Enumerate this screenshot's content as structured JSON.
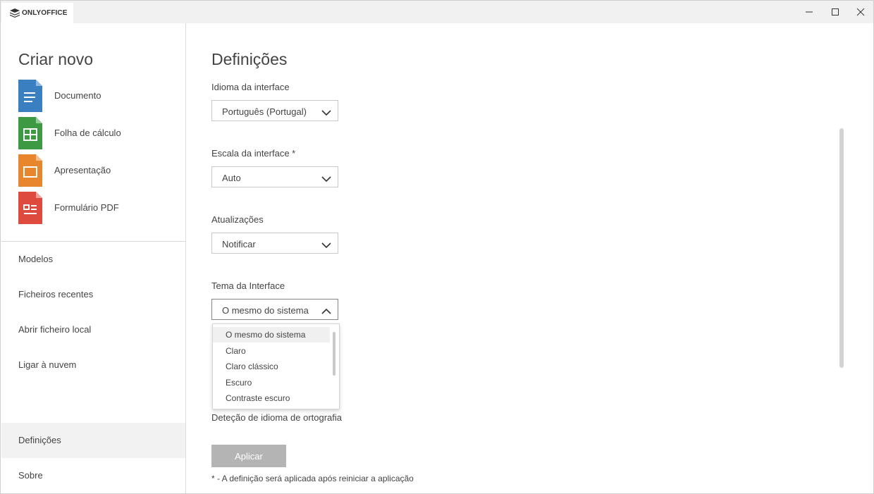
{
  "titlebar": {
    "app_name": "ONLYOFFICE",
    "icons": [
      "onlyoffice-logo-icon",
      "minimize-icon",
      "maximize-icon",
      "close-icon"
    ]
  },
  "sidebar": {
    "create_title": "Criar novo",
    "create_items": [
      {
        "label": "Documento",
        "icon": "document-icon",
        "color": "#3a7fbf"
      },
      {
        "label": "Folha de cálculo",
        "icon": "spreadsheet-icon",
        "color": "#3e9a42"
      },
      {
        "label": "Apresentação",
        "icon": "presentation-icon",
        "color": "#e7862d"
      },
      {
        "label": "Formulário PDF",
        "icon": "pdf-form-icon",
        "color": "#df4a3e"
      }
    ],
    "nav_items": [
      {
        "label": "Modelos"
      },
      {
        "label": "Ficheiros recentes"
      },
      {
        "label": "Abrir ficheiro local"
      },
      {
        "label": "Ligar à nuvem"
      },
      {
        "label": "Definições",
        "active": true
      },
      {
        "label": "Sobre"
      }
    ]
  },
  "main": {
    "title": "Definições",
    "fields": [
      {
        "label": "Idioma da interface",
        "value": "Português (Portugal)"
      },
      {
        "label": "Escala da interface *",
        "value": "Auto"
      },
      {
        "label": "Atualizações",
        "value": "Notificar"
      },
      {
        "label": "Tema da Interface",
        "value": "O mesmo do sistema",
        "open": true
      }
    ],
    "theme_options": [
      "O mesmo do sistema",
      "Claro",
      "Claro clássico",
      "Escuro",
      "Contraste escuro"
    ],
    "spell_label": "Deteção de idioma de ortografia",
    "apply_label": "Aplicar",
    "footnote": "* - A definição será aplicada após reiniciar a aplicação"
  },
  "colors": {
    "apply_button": "#b4b4b4",
    "active_nav": "#f2f2f2"
  }
}
